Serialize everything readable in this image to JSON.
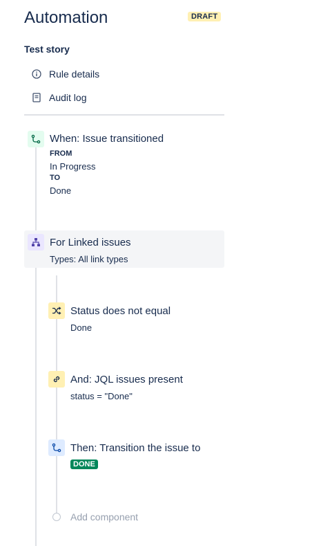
{
  "header": {
    "title": "Automation",
    "status_badge": "DRAFT"
  },
  "rule": {
    "name": "Test story"
  },
  "nav": {
    "items": [
      {
        "icon": "info-icon",
        "label": "Rule details"
      },
      {
        "icon": "document-icon",
        "label": "Audit log"
      }
    ]
  },
  "trigger": {
    "icon": "transition-icon",
    "title": "When: Issue transitioned",
    "from_label": "FROM",
    "from_value": "In Progress",
    "to_label": "TO",
    "to_value": "Done"
  },
  "branch": {
    "icon": "hierarchy-icon",
    "title": "For Linked issues",
    "subtitle": "Types: All link types"
  },
  "conditions": [
    {
      "icon": "shuffle-icon",
      "title": "Status does not equal",
      "subtitle": "Done"
    },
    {
      "icon": "link-icon",
      "title": "And: JQL issues present",
      "subtitle": "status = \"Done\""
    }
  ],
  "action": {
    "icon": "transition-icon",
    "title": "Then: Transition the issue to",
    "status_lozenge": "DONE"
  },
  "add_component": {
    "label": "Add component"
  },
  "colors": {
    "text": "#172b4d",
    "draft_bg": "#fff0b3",
    "done_green": "#00875a",
    "trigger_icon_bg": "#e3fcef",
    "branch_icon_bg": "#eae6ff",
    "condition_icon_bg": "#fff0b3",
    "action_icon_bg": "#deebff",
    "muted": "#97a0af"
  }
}
